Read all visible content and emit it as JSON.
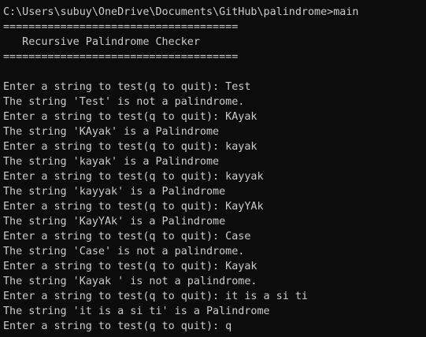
{
  "console": {
    "prompt": "C:\\Users\\subuy\\OneDrive\\Documents\\GitHub\\palindrome>main",
    "banner_top": "=====================================",
    "banner_title": "   Recursive Palindrome Checker",
    "banner_bottom": "=====================================",
    "lines": [
      "Enter a string to test(q to quit): Test",
      "The string 'Test' is not a palindrome.",
      "Enter a string to test(q to quit): KAyak",
      "The string 'KAyak' is a Palindrome",
      "Enter a string to test(q to quit): kayak",
      "The string 'kayak' is a Palindrome",
      "Enter a string to test(q to quit): kayyak",
      "The string 'kayyak' is a Palindrome",
      "Enter a string to test(q to quit): KayYAk",
      "The string 'KayYAk' is a Palindrome",
      "Enter a string to test(q to quit): Case",
      "The string 'Case' is not a palindrome.",
      "Enter a string to test(q to quit): Kayak",
      "The string 'Kayak ' is not a palindrome.",
      "Enter a string to test(q to quit): it is a si ti",
      "The string 'it is a si ti' is a Palindrome",
      "Enter a string to test(q to quit): q"
    ]
  }
}
